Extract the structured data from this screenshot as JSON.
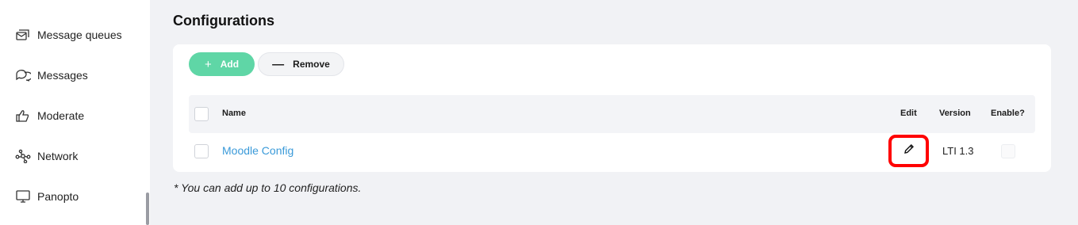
{
  "sidebar": {
    "items": [
      {
        "label": "Message queues",
        "icon": "message-queue-icon"
      },
      {
        "label": "Messages",
        "icon": "chat-bubbles-icon"
      },
      {
        "label": "Moderate",
        "icon": "thumbs-up-icon"
      },
      {
        "label": "Network",
        "icon": "network-icon"
      },
      {
        "label": "Panopto",
        "icon": "monitor-icon"
      }
    ]
  },
  "main": {
    "title": "Configurations",
    "toolbar": {
      "add_label": "Add",
      "remove_label": "Remove",
      "add_glyph": "+",
      "remove_glyph": "—"
    },
    "table": {
      "columns": {
        "name": "Name",
        "edit": "Edit",
        "version": "Version",
        "enable": "Enable?"
      },
      "rows": [
        {
          "name": "Moodle Config",
          "version": "LTI 1.3",
          "enabled": false
        }
      ]
    },
    "note": "* You can add up to 10 configurations."
  },
  "colors": {
    "accent_green": "#5fd6a6",
    "link_blue": "#3a9ad9",
    "highlight_red": "#ff0000"
  }
}
